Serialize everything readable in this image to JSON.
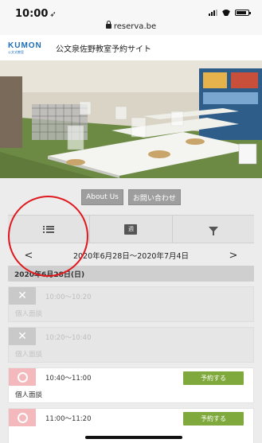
{
  "status_bar": {
    "time": "10:00",
    "url": "reserva.be"
  },
  "site": {
    "logo_text": "KUMON",
    "logo_sub": "公文式教室",
    "title": "公文泉佐野教室予約サイト"
  },
  "links": {
    "about": "About Us",
    "contact": "お問い合わせ"
  },
  "view_tabs": {
    "list_icon": "list-icon",
    "week_label": "週",
    "filter_icon": "filter-icon"
  },
  "range": {
    "prev": "<",
    "text": "2020年6月28日～2020年7月4日",
    "next": ">"
  },
  "date_header": "2020年6月28日(日)",
  "slots": [
    {
      "status": "closed",
      "status_mark": "✕",
      "time": "10:00～10:20",
      "name": "個人面談"
    },
    {
      "status": "closed",
      "status_mark": "✕",
      "time": "10:20～10:40",
      "name": "個人面談"
    },
    {
      "status": "open",
      "time": "10:40～11:00",
      "name": "個人面談",
      "button": "予約する"
    },
    {
      "status": "open",
      "time": "11:00～11:20",
      "name": "",
      "button": "予約する"
    }
  ],
  "colors": {
    "accent_green": "#7fa93c",
    "open_pink": "#f3b9bd",
    "annotation_red": "#e0181e",
    "kumon_blue": "#1b6db8"
  }
}
